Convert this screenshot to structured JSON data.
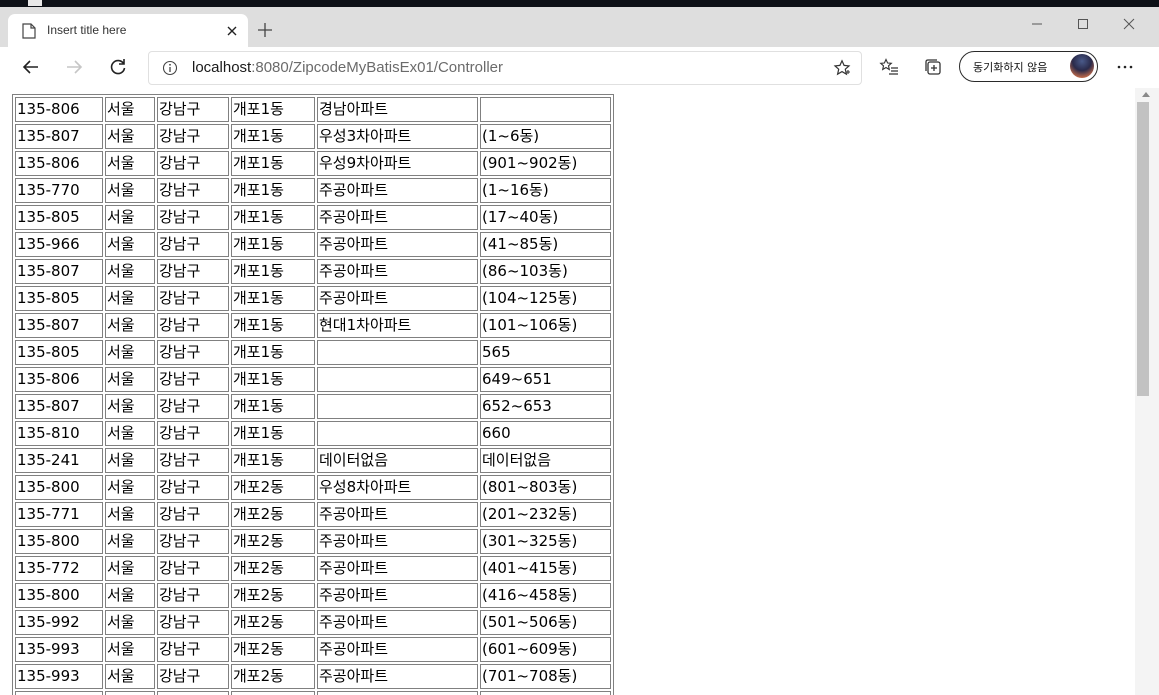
{
  "tab": {
    "title": "Insert title here"
  },
  "address": {
    "host": "localhost",
    "path": ":8080/ZipcodeMyBatisEx01/Controller"
  },
  "sync": {
    "label": "동기화하지 않음"
  },
  "table": {
    "rows": [
      [
        "135-806",
        "서울",
        "강남구",
        "개포1동",
        "경남아파트",
        ""
      ],
      [
        "135-807",
        "서울",
        "강남구",
        "개포1동",
        "우성3차아파트",
        "(1~6동)"
      ],
      [
        "135-806",
        "서울",
        "강남구",
        "개포1동",
        "우성9차아파트",
        "(901~902동)"
      ],
      [
        "135-770",
        "서울",
        "강남구",
        "개포1동",
        "주공아파트",
        "(1~16동)"
      ],
      [
        "135-805",
        "서울",
        "강남구",
        "개포1동",
        "주공아파트",
        "(17~40동)"
      ],
      [
        "135-966",
        "서울",
        "강남구",
        "개포1동",
        "주공아파트",
        "(41~85동)"
      ],
      [
        "135-807",
        "서울",
        "강남구",
        "개포1동",
        "주공아파트",
        "(86~103동)"
      ],
      [
        "135-805",
        "서울",
        "강남구",
        "개포1동",
        "주공아파트",
        "(104~125동)"
      ],
      [
        "135-807",
        "서울",
        "강남구",
        "개포1동",
        "현대1차아파트",
        "(101~106동)"
      ],
      [
        "135-805",
        "서울",
        "강남구",
        "개포1동",
        "",
        "565"
      ],
      [
        "135-806",
        "서울",
        "강남구",
        "개포1동",
        "",
        "649~651"
      ],
      [
        "135-807",
        "서울",
        "강남구",
        "개포1동",
        "",
        "652~653"
      ],
      [
        "135-810",
        "서울",
        "강남구",
        "개포1동",
        "",
        "660"
      ],
      [
        "135-241",
        "서울",
        "강남구",
        "개포1동",
        "데이터없음",
        "데이터없음"
      ],
      [
        "135-800",
        "서울",
        "강남구",
        "개포2동",
        "우성8차아파트",
        "(801~803동)"
      ],
      [
        "135-771",
        "서울",
        "강남구",
        "개포2동",
        "주공아파트",
        "(201~232동)"
      ],
      [
        "135-800",
        "서울",
        "강남구",
        "개포2동",
        "주공아파트",
        "(301~325동)"
      ],
      [
        "135-772",
        "서울",
        "강남구",
        "개포2동",
        "주공아파트",
        "(401~415동)"
      ],
      [
        "135-800",
        "서울",
        "강남구",
        "개포2동",
        "주공아파트",
        "(416~458동)"
      ],
      [
        "135-992",
        "서울",
        "강남구",
        "개포2동",
        "주공아파트",
        "(501~506동)"
      ],
      [
        "135-993",
        "서울",
        "강남구",
        "개포2동",
        "주공아파트",
        "(601~609동)"
      ],
      [
        "135-993",
        "서울",
        "강남구",
        "개포2동",
        "주공아파트",
        "(701~708동)"
      ],
      [
        "",
        "",
        "",
        "",
        "",
        ""
      ]
    ]
  }
}
